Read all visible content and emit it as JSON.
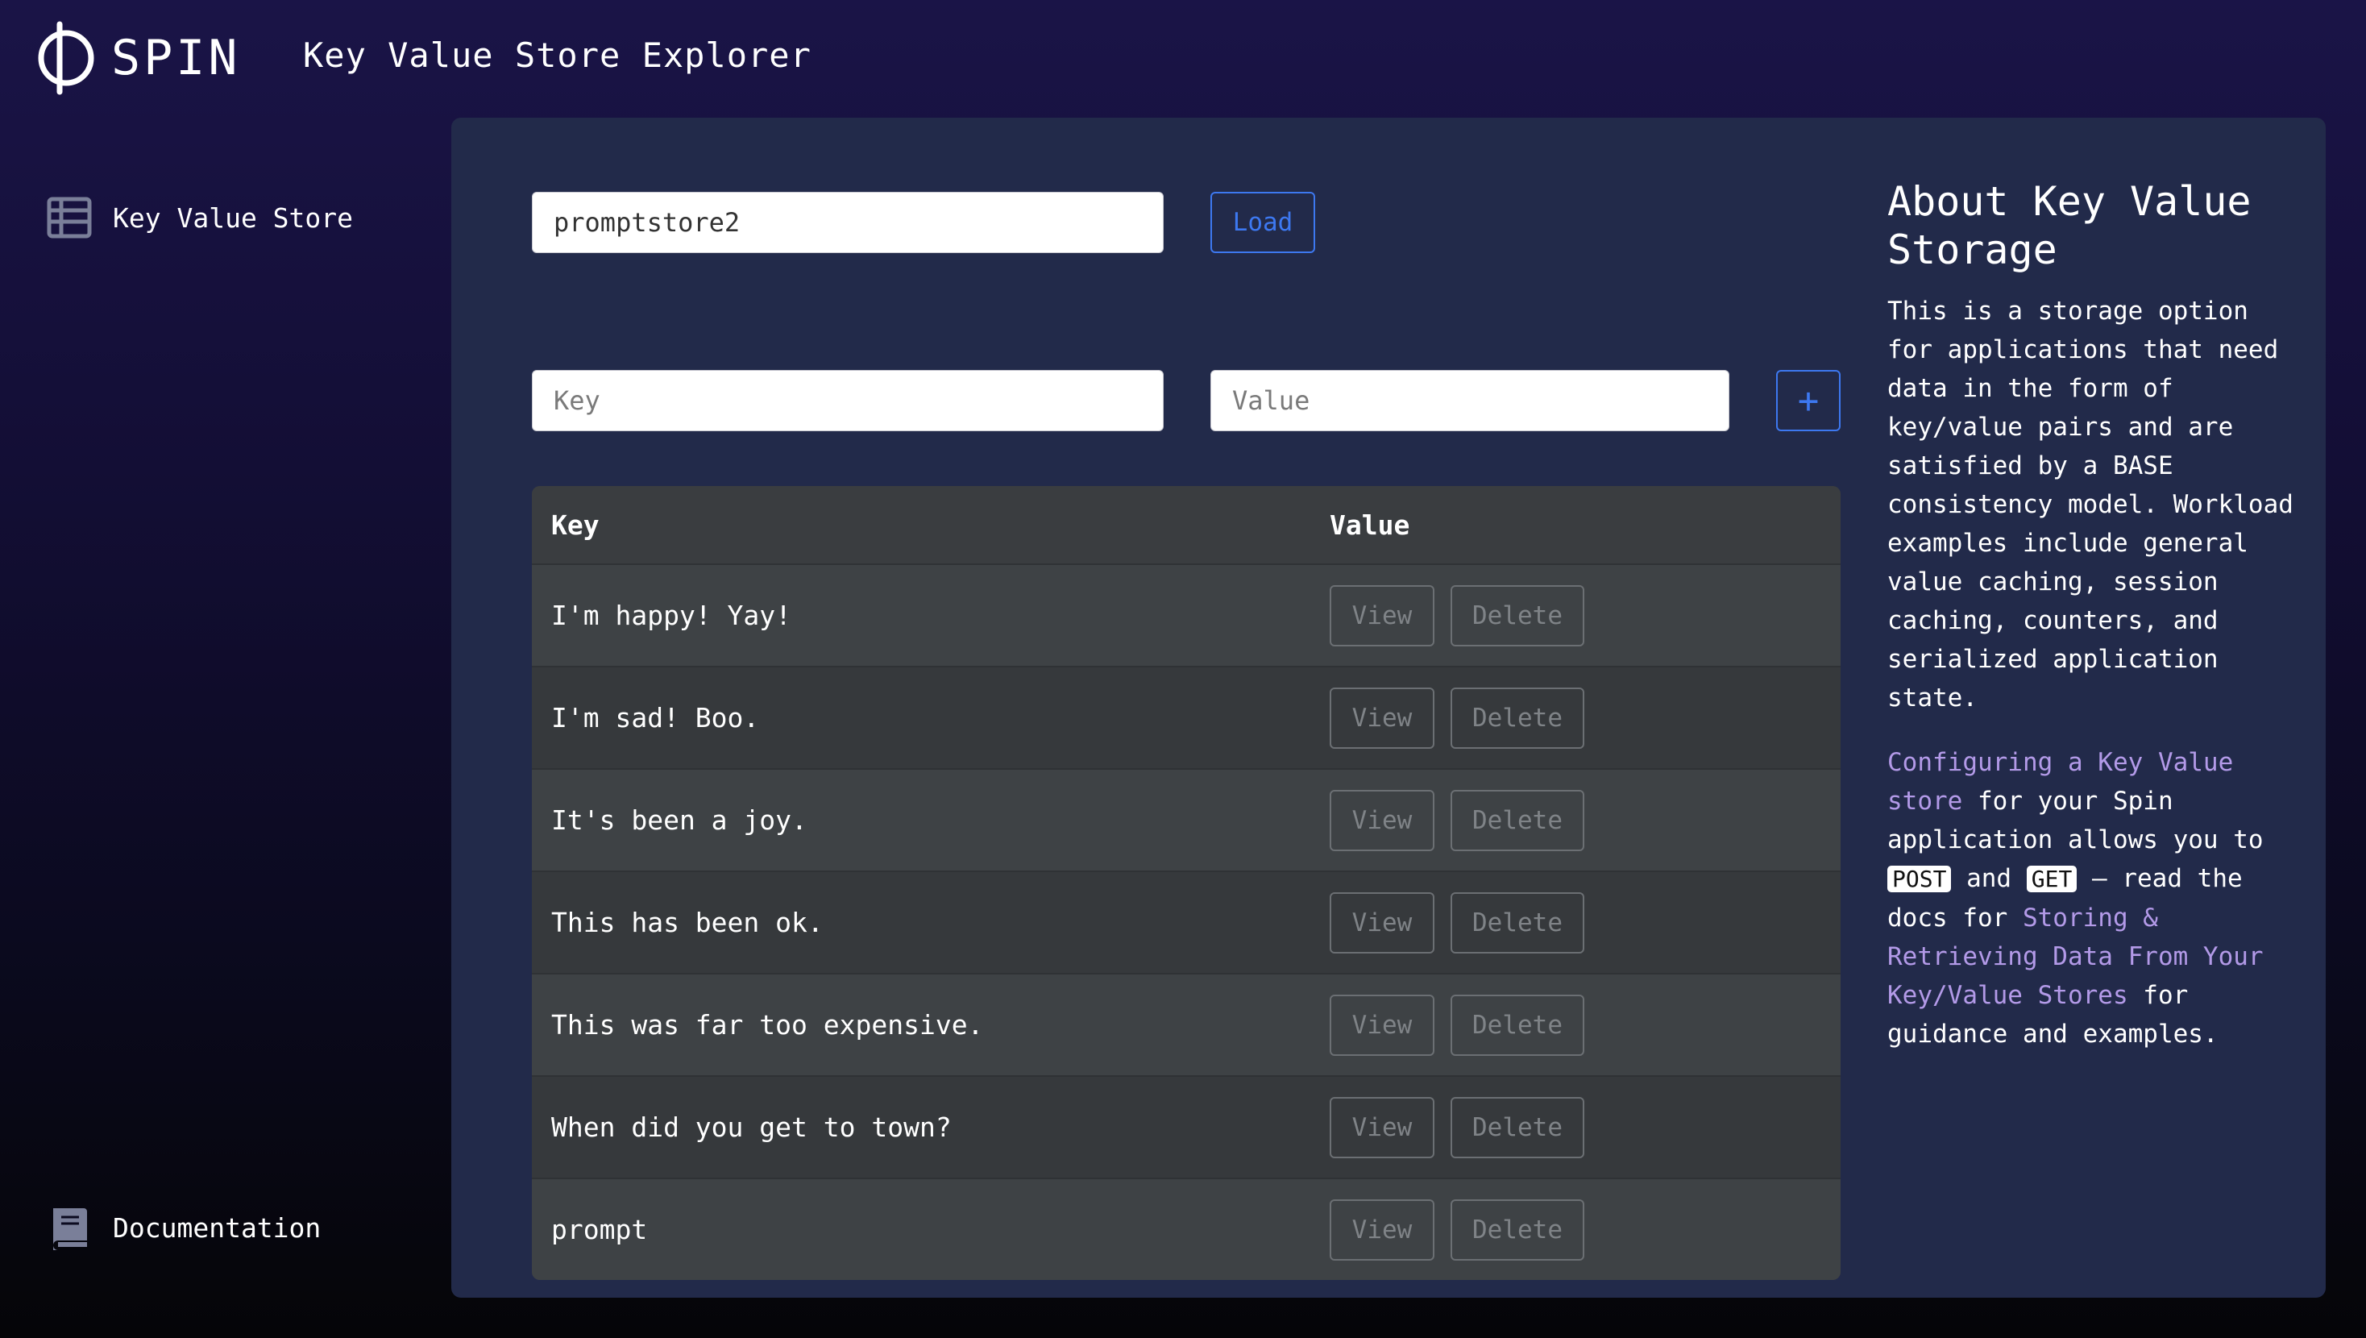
{
  "header": {
    "logo_text": "SPIN",
    "title": "Key Value Store Explorer"
  },
  "sidebar": {
    "items": [
      {
        "label": "Key Value Store",
        "icon": "table-list-icon"
      },
      {
        "label": "Documentation",
        "icon": "book-icon"
      }
    ]
  },
  "store": {
    "name_value": "promptstore2",
    "load_label": "Load"
  },
  "new_entry": {
    "key_placeholder": "Key",
    "value_placeholder": "Value",
    "add_label": "+"
  },
  "table": {
    "headers": {
      "key": "Key",
      "value": "Value"
    },
    "view_label": "View",
    "delete_label": "Delete",
    "rows": [
      {
        "key": "I'm happy! Yay!"
      },
      {
        "key": "I'm sad! Boo."
      },
      {
        "key": "It's been a joy."
      },
      {
        "key": "This has been ok."
      },
      {
        "key": "This was far too expensive."
      },
      {
        "key": "When did you get to town?"
      },
      {
        "key": "prompt"
      }
    ]
  },
  "about": {
    "title": "About Key Value Storage",
    "description": "This is a storage option for applications that need data in the form of key/value pairs and are satisfied by a BASE consistency model. Workload examples include general value caching, session caching, counters, and serialized application state.",
    "config_link": "Configuring a Key Value store",
    "text_1": " for your Spin application allows you to ",
    "post_badge": "POST",
    "text_2": " and ",
    "get_badge": "GET",
    "text_3": " — read the docs for ",
    "docs_link": "Storing & Retrieving Data From Your Key/Value Stores",
    "text_4": " for guidance and examples."
  },
  "colors": {
    "accent_blue": "#3d78f0",
    "link_purple": "#b39ae8",
    "panel_bg": "#222a4a"
  }
}
